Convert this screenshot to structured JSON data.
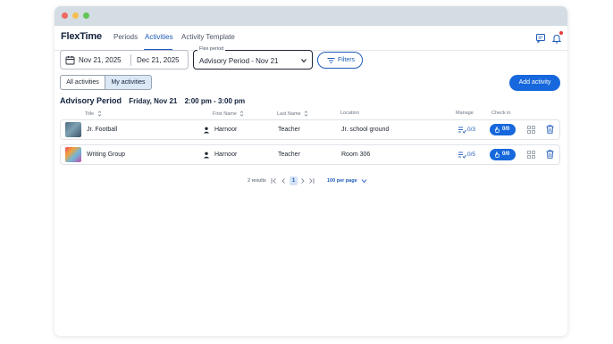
{
  "window": {
    "title_bar_controls": [
      "close",
      "minimize",
      "maximize"
    ]
  },
  "nav": {
    "logo": "FlexTime",
    "tabs": [
      {
        "label": "Periods",
        "active": false
      },
      {
        "label": "Activities",
        "active": true
      },
      {
        "label": "Activity Template",
        "active": false
      }
    ],
    "icons": [
      "chat-icon",
      "bell-icon"
    ],
    "has_notification": true
  },
  "filters": {
    "date_start": "Nov 21, 2025",
    "date_end": "Dec 21, 2025",
    "flex_period_label": "Flex period",
    "flex_period_value": "Advisory Period - Nov 21",
    "filters_button": "Filters"
  },
  "view_toggle": {
    "all_label": "All activities",
    "mine_label": "My activities",
    "selected": "My activities"
  },
  "add_activity_label": "Add activity",
  "period": {
    "title": "Advisory Period",
    "day": "Friday, Nov 21",
    "time": "2:00 pm - 3:00 pm"
  },
  "table": {
    "headers": {
      "title": "Title",
      "first_name": "First Name",
      "last_name": "Last Name",
      "location": "Location",
      "manage": "Manage",
      "check_in": "Check in"
    },
    "rows": [
      {
        "title": "Jr. Football",
        "first_name": "Harnoor",
        "last_name": "Teacher",
        "location": "Jr. school ground",
        "manage": "0/3",
        "check_in": "0/0"
      },
      {
        "title": "Writing Group",
        "first_name": "Harnoor",
        "last_name": "Teacher",
        "location": "Room 306",
        "manage": "0/5",
        "check_in": "0/0"
      }
    ]
  },
  "pagination": {
    "results": "2 results",
    "current_page": "1",
    "page_size": "100 per page"
  },
  "colors": {
    "accent": "#1668dc",
    "nav_active": "#1e5bb8",
    "title_bar": "#d4dce4",
    "selected_toggle": "#dce8f6"
  }
}
